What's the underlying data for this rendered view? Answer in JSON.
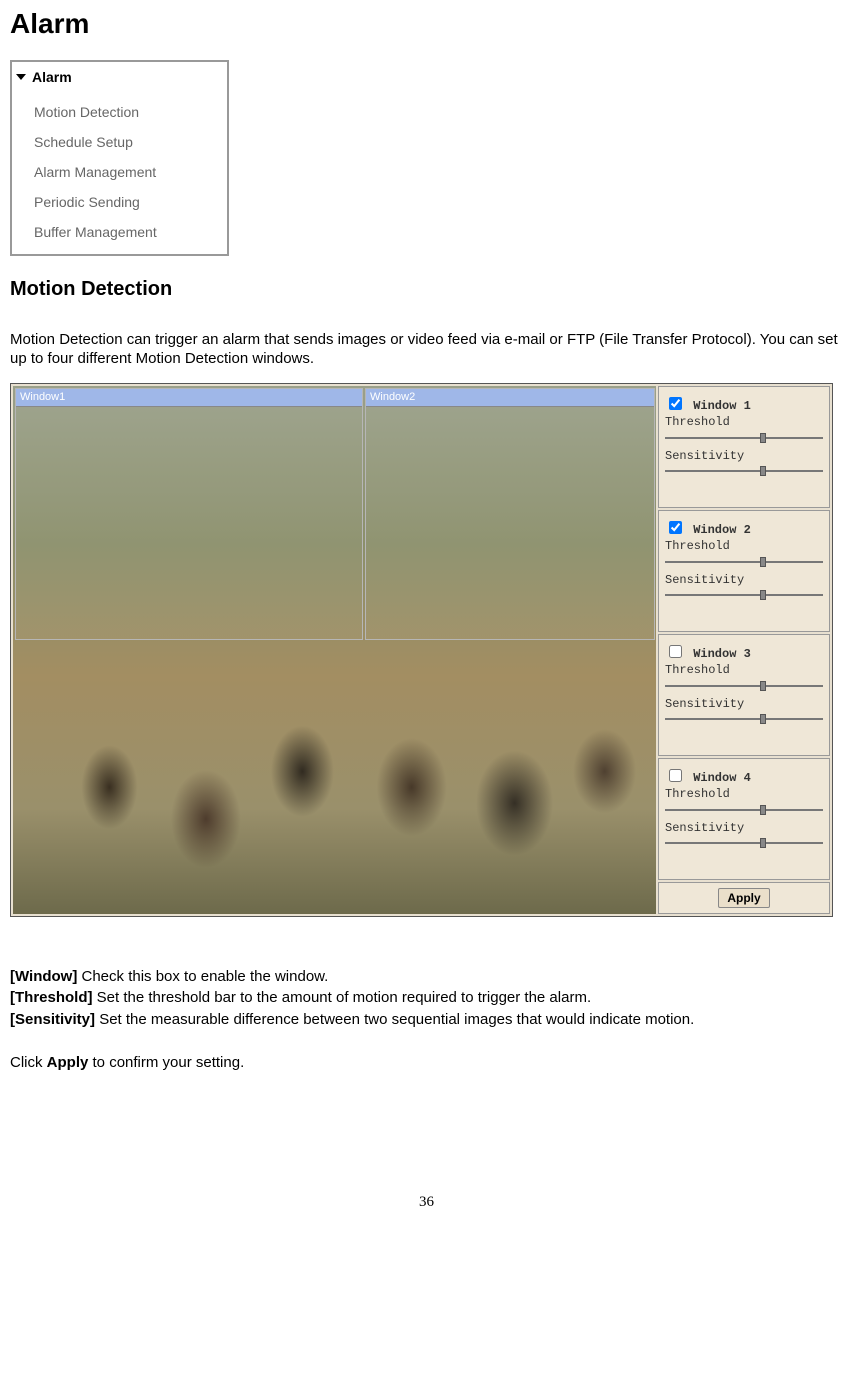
{
  "title": "Alarm",
  "menu": {
    "header": "Alarm",
    "items": [
      "Motion Detection",
      "Schedule Setup",
      "Alarm Management",
      "Periodic Sending",
      "Buffer Management"
    ]
  },
  "section_title": "Motion Detection",
  "intro": "Motion Detection can trigger an alarm that sends images or video feed via e-mail or FTP (File Transfer Protocol). You can set up to four different Motion Detection windows.",
  "figure": {
    "video_windows": [
      {
        "label": "Window1"
      },
      {
        "label": "Window2"
      }
    ],
    "controls": [
      {
        "checked": true,
        "title": "Window 1",
        "threshold": "Threshold",
        "sensitivity": "Sensitivity"
      },
      {
        "checked": true,
        "title": "Window 2",
        "threshold": "Threshold",
        "sensitivity": "Sensitivity"
      },
      {
        "checked": false,
        "title": "Window 3",
        "threshold": "Threshold",
        "sensitivity": "Sensitivity"
      },
      {
        "checked": false,
        "title": "Window 4",
        "threshold": "Threshold",
        "sensitivity": "Sensitivity"
      }
    ],
    "apply_label": "Apply"
  },
  "defs": {
    "window_key": "[Window]",
    "window_text": " Check this box to enable the window.",
    "threshold_key": "[Threshold]",
    "threshold_text": " Set the threshold bar to the amount of motion required to trigger the alarm.",
    "sensitivity_key": "[Sensitivity]",
    "sensitivity_text": " Set the measurable difference between two sequential images that would indicate motion."
  },
  "confirm_prefix": "Click ",
  "confirm_bold": "Apply",
  "confirm_suffix": " to confirm your setting.",
  "page_number": "36"
}
